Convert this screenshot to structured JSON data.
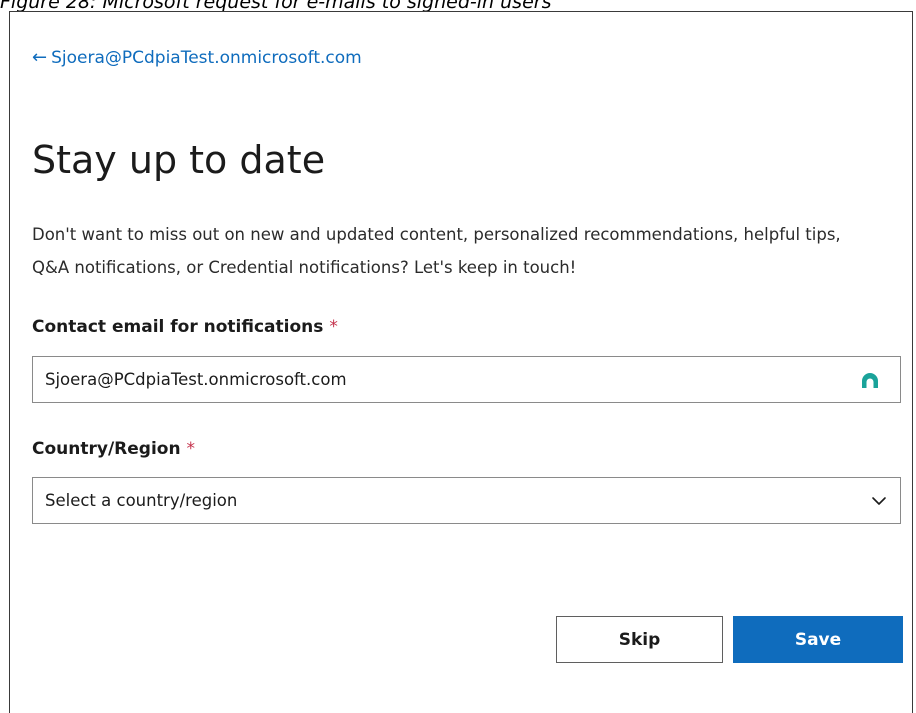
{
  "caption": "Figure 28: Microsoft request for e-mails to signed-in users",
  "back_link": {
    "arrow": "←",
    "account": "Sjoera@PCdpiaTest.onmicrosoft.com"
  },
  "title": "Stay up to date",
  "description": "Don't want to miss out on new and updated content, personalized recommendations, helpful tips, Q&A notifications, or Credential notifications? Let's keep in touch!",
  "email_field": {
    "label": "Contact email for notifications",
    "required_mark": "*",
    "value": "Sjoera@PCdpiaTest.onmicrosoft.com",
    "extension_icon": "password-manager-icon"
  },
  "country_field": {
    "label": "Country/Region",
    "required_mark": "*",
    "selected": "Select a country/region",
    "icon": "chevron-down-icon"
  },
  "buttons": {
    "skip": "Skip",
    "save": "Save"
  },
  "colors": {
    "accent": "#0f6cbd",
    "required": "#c4314b",
    "extension_icon": "#1aa39a"
  }
}
